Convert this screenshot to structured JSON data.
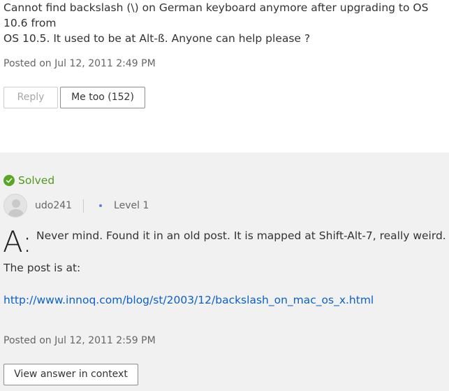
{
  "question": {
    "text": "Cannot find backslash (\\) on German keyboard anymore after upgrading to OS 10.6 from\nOS 10.5. It used to be at Alt-ß. Anyone can help please ?",
    "posted": "Posted on Jul 12, 2011 2:49 PM",
    "reply_label": "Reply",
    "metoo_label": "Me too (152)"
  },
  "answer": {
    "solved_label": "Solved",
    "author": "udo241",
    "level": "Level 1",
    "a_marker": "A:",
    "line1": "Never mind. Found it in an old post. It is mapped at Shift-Alt-7, really weird.",
    "line2": "The post is at:",
    "link": "http://www.innoq.com/blog/st/2003/12/backslash_on_mac_os_x.html",
    "posted": "Posted on Jul 12, 2011 2:59 PM",
    "context_label": "View answer in context"
  },
  "colors": {
    "solved_green": "#58a626",
    "link_blue": "#0b60c9",
    "answer_bg": "#f1f1f1",
    "level_dot": "#5b84e0"
  },
  "icons": {
    "solved": "check-circle-icon",
    "avatar": "user-avatar-icon"
  }
}
